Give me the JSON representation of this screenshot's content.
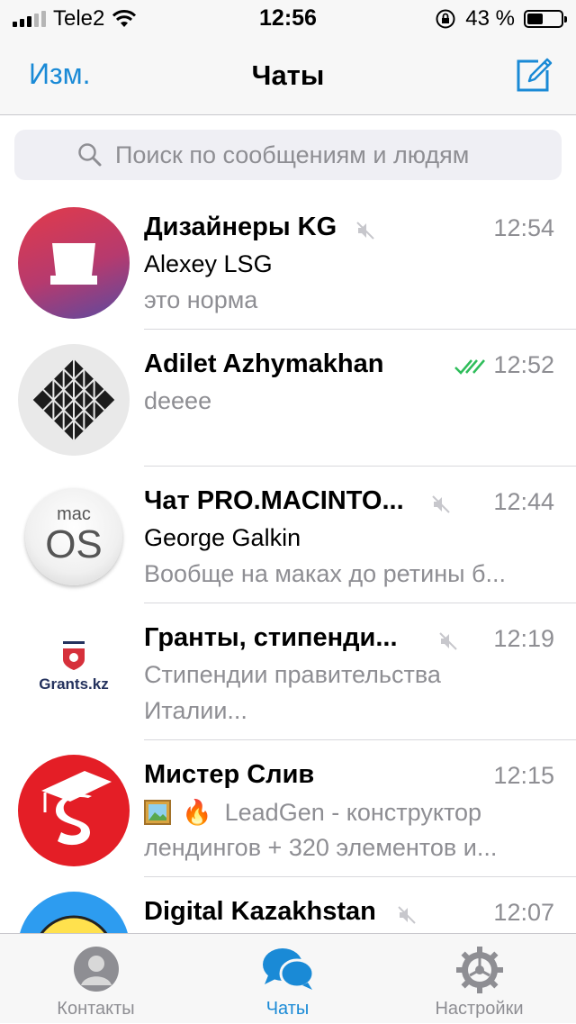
{
  "status_bar": {
    "carrier": "Tele2",
    "time": "12:56",
    "battery_percent": "43 %",
    "battery_level": 0.43
  },
  "nav": {
    "edit_label": "Изм.",
    "title": "Чаты",
    "compose_icon": "compose-icon"
  },
  "search": {
    "placeholder": "Поиск по сообщениям и людям"
  },
  "chats": [
    {
      "name": "Дизайнеры KG",
      "time": "12:54",
      "sender": "Alexey LSG",
      "message": "это норма",
      "muted": true
    },
    {
      "name": "Adilet Azhymakhan",
      "time": "12:52",
      "message": "deeee",
      "read": true
    },
    {
      "name": "Чат PRO.MACINTO...",
      "time": "12:44",
      "sender": "George Galkin",
      "message": "Вообще на маках до ретины б...",
      "muted": true,
      "avatar_text_top": "mac",
      "avatar_text_bottom": "OS"
    },
    {
      "name": "Гранты, стипенди...",
      "time": "12:19",
      "message_line1": "Стипендии правительства",
      "message_line2": "Италии...",
      "muted": true,
      "avatar_text": "Grants.kz"
    },
    {
      "name": "Мистер Слив",
      "time": "12:15",
      "message_line1": "LeadGen - конструктор",
      "message_line2": "лендингов + 320 элементов и...",
      "emoji": "🔥"
    },
    {
      "name": "Digital Kazakhstan",
      "time": "12:07",
      "muted": true
    }
  ],
  "tabs": [
    {
      "label": "Контакты",
      "icon": "contacts-icon"
    },
    {
      "label": "Чаты",
      "icon": "chats-icon",
      "active": true
    },
    {
      "label": "Настройки",
      "icon": "settings-icon"
    }
  ],
  "colors": {
    "accent": "#1a8ad6",
    "secondary_text": "#8e8e93",
    "read_check": "#2ebd5a"
  }
}
